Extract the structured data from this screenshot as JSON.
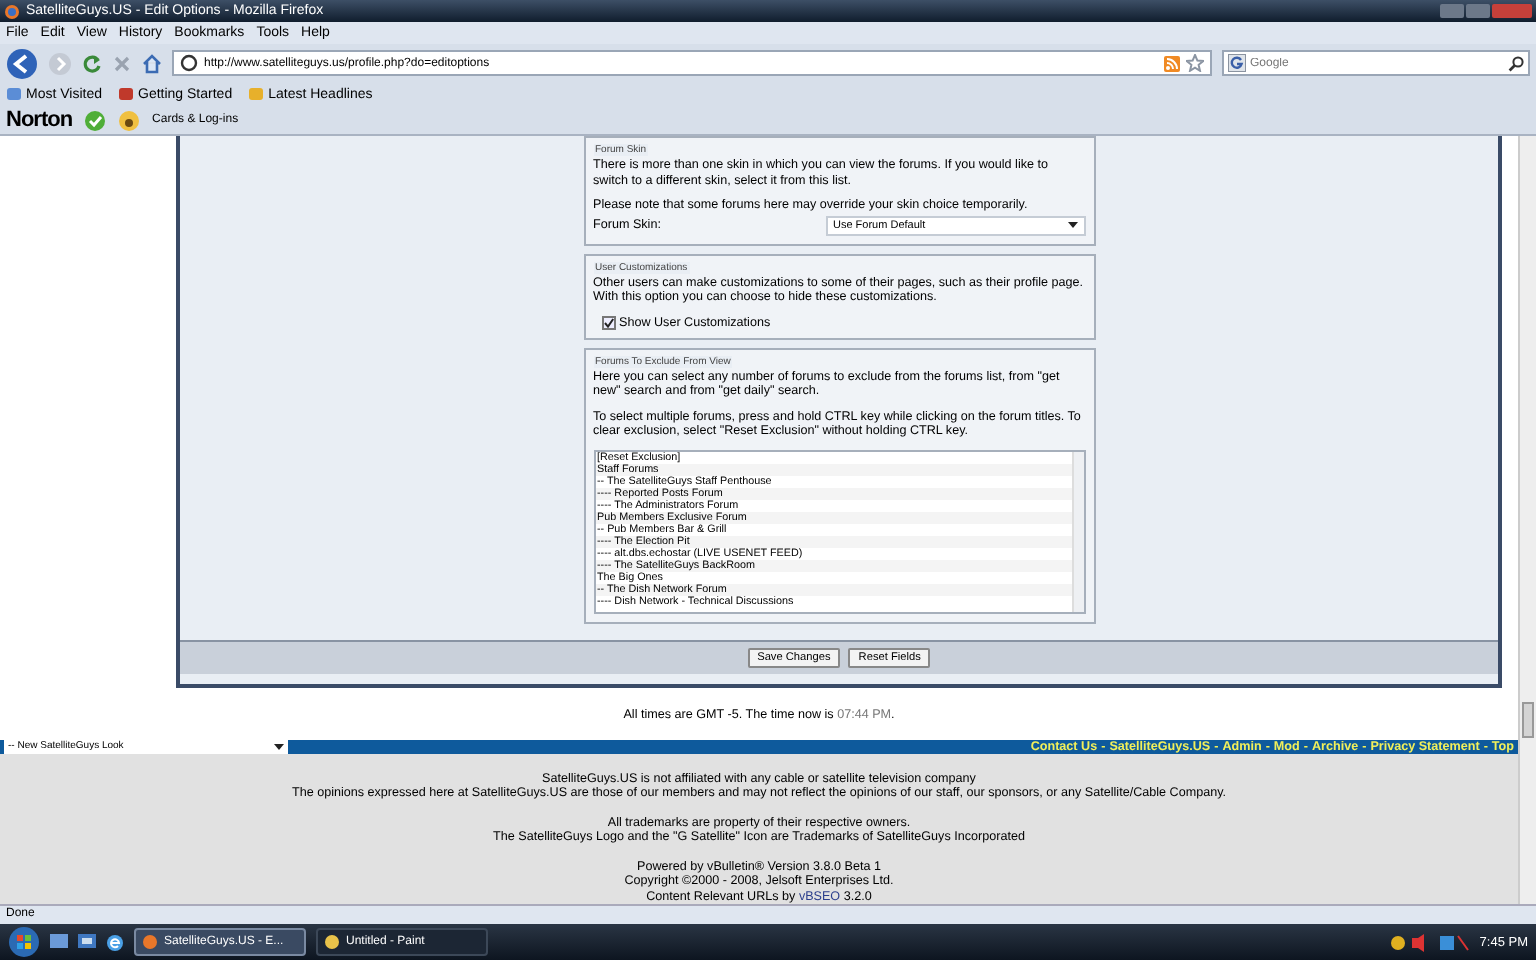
{
  "window": {
    "title": "SatelliteGuys.US - Edit Options - Mozilla Firefox"
  },
  "menu": [
    "File",
    "Edit",
    "View",
    "History",
    "Bookmarks",
    "Tools",
    "Help"
  ],
  "address": {
    "value": "http://www.satelliteguys.us/profile.php?do=editoptions"
  },
  "search": {
    "placeholder": "Google"
  },
  "bookmarks": [
    "Most Visited",
    "Getting Started",
    "Latest Headlines"
  ],
  "norton": {
    "brand": "Norton",
    "cards": "Cards & Log-ins"
  },
  "forum_skin": {
    "legend": "Forum Skin",
    "text": "There is more than one skin in which you can view the forums. If you would like to switch to a different skin, select it from this list.",
    "note": "Please note that some forums here may override your skin choice temporarily.",
    "label": "Forum Skin:",
    "value": "Use Forum Default"
  },
  "user_customizations": {
    "legend": "User Customizations",
    "text": "Other users can make customizations to some of their pages, such as their profile page. With this option you can choose to hide these customizations.",
    "checkbox": {
      "label": "Show User Customizations",
      "checked": true
    }
  },
  "exclude": {
    "legend": "Forums To Exclude From View",
    "text": "Here you can select any number of forums to exclude from the forums list, from \"get new\" search and from \"get daily\" search.",
    "note": "To select multiple forums, press and hold CTRL key while clicking on the forum titles. To clear exclusion, select \"Reset Exclusion\" without holding CTRL key.",
    "options": [
      {
        "label": "[Reset Exclusion]",
        "selected": false
      },
      {
        "label": "Staff Forums",
        "selected": false
      },
      {
        "label": "-- The SatelliteGuys Staff Penthouse",
        "selected": false
      },
      {
        "label": "---- Reported Posts Forum",
        "selected": false
      },
      {
        "label": "---- The Administrators Forum",
        "selected": false
      },
      {
        "label": "Pub Members Exclusive Forum",
        "selected": false
      },
      {
        "label": "-- Pub Members Bar & Grill",
        "selected": false
      },
      {
        "label": "---- The Election Pit",
        "selected": false
      },
      {
        "label": "---- alt.dbs.echostar (LIVE USENET FEED)",
        "selected": false
      },
      {
        "label": "---- The SatelliteGuys BackRoom",
        "selected": false
      },
      {
        "label": "The Big Ones",
        "selected": false
      },
      {
        "label": "-- The Dish Network Forum",
        "selected": false
      },
      {
        "label": "---- Dish Network - Technical Discussions",
        "selected": false
      }
    ]
  },
  "buttons": [
    "Save Changes",
    "Reset Fields"
  ],
  "time_line": {
    "text": "All times are GMT -5. The time now is",
    "time": "07:44 PM",
    "end": "."
  },
  "style_select": {
    "value": "-- New SatelliteGuys Look"
  },
  "footer_links": [
    "Contact Us",
    "SatelliteGuys.US",
    "Admin",
    "Mod",
    "Archive",
    "Privacy Statement",
    "Top"
  ],
  "footer_separator": "-",
  "footer_lines": [
    [
      "SatelliteGuys.US is not affiliated with any cable or satellite television company",
      "The opinions expressed here at SatelliteGuys.US are those of our members and may not reflect the opinions of our staff, our sponsors, or any Satellite/Cable Company."
    ],
    [
      "All trademarks are property of their respective owners.",
      "The SatelliteGuys Logo and the \"G Satellite\" Icon are Trademarks of SatelliteGuys Incorporated"
    ],
    [
      "Powered by vBulletin® Version 3.8.0 Beta 1",
      "Copyright ©2000 - 2008, Jelsoft Enterprises Ltd."
    ]
  ],
  "seo": {
    "before": "Content Relevant URLs by",
    "link": "vBSEO",
    "after": "3.2.0"
  },
  "status_bar": "Done",
  "taskbar": {
    "tasks": [
      {
        "label": "SatelliteGuys.US - E...",
        "selected": true
      },
      {
        "label": "Untitled - Paint",
        "selected": false
      }
    ],
    "clock": "7:45 PM"
  }
}
